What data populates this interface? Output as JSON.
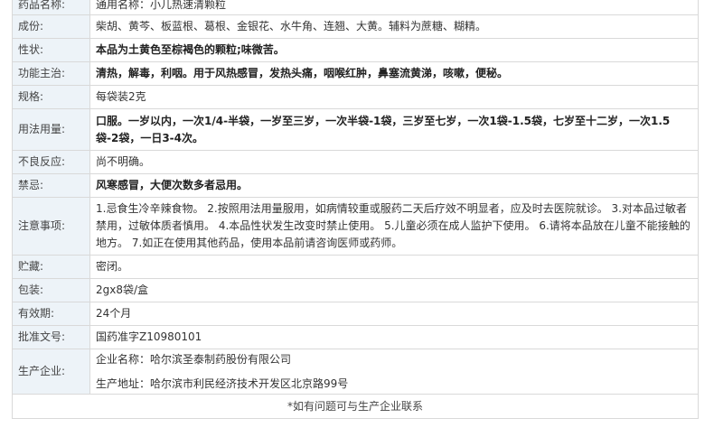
{
  "rows": [
    {
      "label": "药品名称:",
      "value": "通用名称：小儿热速清颗粒"
    },
    {
      "label": "成份:",
      "value": "柴胡、黄芩、板蓝根、葛根、金银花、水牛角、连翘、大黄。辅料为蔗糖、糊精。"
    },
    {
      "label": "性状:",
      "value": "本品为土黄色至棕褐色的颗粒;味微苦。"
    },
    {
      "label": "功能主治:",
      "value": "清热，解毒，利咽。用于风热感冒，发热头痛，咽喉红肿，鼻塞流黄涕，咳嗽，便秘。"
    },
    {
      "label": "规格:",
      "value": "每袋装2克"
    },
    {
      "label": "用法用量:",
      "value": "口服。一岁以内，一次1/4-半袋，一岁至三岁，一次半袋-1袋，三岁至七岁，一次1袋-1.5袋，七岁至十二岁，一次1.5袋-2袋，一日3-4次。"
    },
    {
      "label": "不良反应:",
      "value": "尚不明确。"
    },
    {
      "label": "禁忌:",
      "value": "风寒感冒，大便次数多者忌用。"
    },
    {
      "label": "注意事项:",
      "value": "1.忌食生冷辛辣食物。 2.按照用法用量服用，如病情较重或服药二天后疗效不明显者，应及时去医院就诊。 3.对本品过敏者禁用，过敏体质者慎用。 4.本品性状发生改变时禁止使用。 5.儿童必须在成人监护下使用。 6.请将本品放在儿童不能接触的地方。 7.如正在使用其他药品，使用本品前请咨询医师或药师。"
    },
    {
      "label": "贮藏:",
      "value": "密闭。"
    },
    {
      "label": "包装:",
      "value": "2gx8袋/盒"
    },
    {
      "label": "有效期:",
      "value": "24个月"
    },
    {
      "label": "批准文号:",
      "value": "国药准字Z10980101"
    }
  ],
  "manufacturer": {
    "label": "生产企业:",
    "name_line": "企业名称：哈尔滨圣泰制药股份有限公司",
    "address_line": "生产地址：哈尔滨市利民经济技术开发区北京路99号"
  },
  "footer": "*如有问题可与生产企业联系"
}
